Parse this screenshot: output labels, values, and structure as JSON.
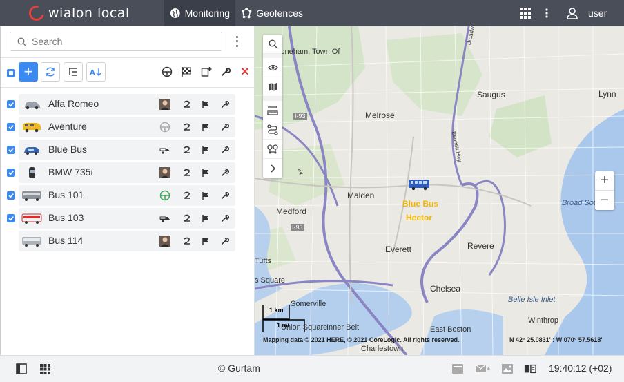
{
  "header": {
    "logo_text": "wialon local",
    "tabs": [
      {
        "label": "Monitoring",
        "icon": "globe-icon",
        "active": true
      },
      {
        "label": "Geofences",
        "icon": "geofence-icon",
        "active": false
      }
    ],
    "user_label": "user"
  },
  "sidebar": {
    "search": {
      "placeholder": "Search",
      "value": ""
    },
    "units": [
      {
        "name": "Alfa Romeo",
        "checked": true,
        "driver": "driver-photo"
      },
      {
        "name": "Aventure",
        "checked": true,
        "driver": "steering-wheel-icon"
      },
      {
        "name": "Blue Bus",
        "checked": true,
        "driver": "trailer-icon"
      },
      {
        "name": "BMW 735i",
        "checked": true,
        "driver": "driver-photo"
      },
      {
        "name": "Bus 101",
        "checked": true,
        "driver": "steering-wheel-green-icon"
      },
      {
        "name": "Bus 103",
        "checked": true,
        "driver": "trailer-icon"
      },
      {
        "name": "Bus 114",
        "checked": false,
        "driver": "driver-photo"
      }
    ]
  },
  "map": {
    "labels": [
      "Stoneham, Town Of",
      "Saugus",
      "Lynn",
      "Melrose",
      "Malden",
      "Medford",
      "Everett",
      "Revere",
      "Broad Sou",
      "Tufts",
      "s Square",
      "Chelsea",
      "Somerville",
      "Belle Isle Inlet",
      "Winthrop",
      "Union Square",
      "Inner Belt",
      "East Boston",
      "Charlestown",
      "I-93",
      "I-93",
      "24",
      "Bennett Hwy",
      "Broadway"
    ],
    "unit_label_1": "Blue Bus",
    "unit_label_2": "Hector",
    "scale_km": "1 km",
    "scale_mi": "1 mi",
    "attribution": "Mapping data © 2021 HERE, © 2021 CoreLogic. All rights reserved.",
    "coordinates": "N 42° 25.0831' : W 070° 57.5618'"
  },
  "footer": {
    "copyright": "© Gurtam",
    "time": "19:40:12 (+02)"
  },
  "colors": {
    "topbar": "#4a4e59",
    "accent": "#3c8af0",
    "delete": "#e4403c",
    "unit_label": "#f5b800"
  }
}
